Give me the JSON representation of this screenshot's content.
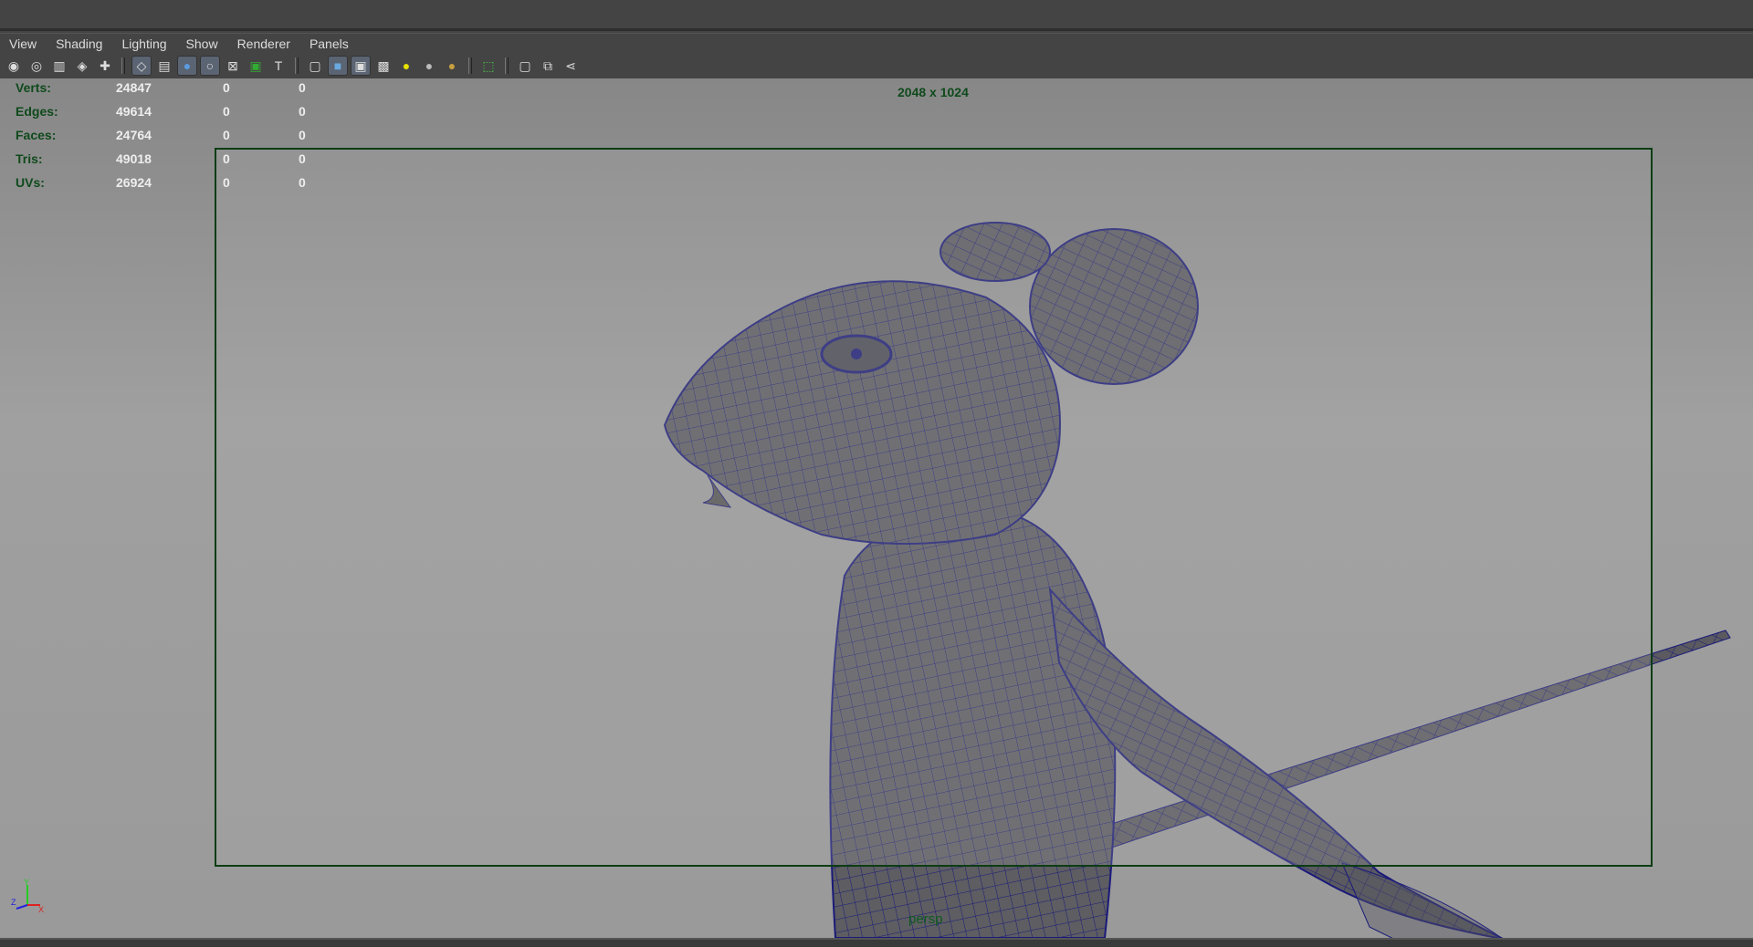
{
  "menu": [
    "View",
    "Shading",
    "Lighting",
    "Show",
    "Renderer",
    "Panels"
  ],
  "toolbar": [
    {
      "icon": "camera-select-icon"
    },
    {
      "icon": "camera-attributes-icon"
    },
    {
      "icon": "bookmark-icon"
    },
    {
      "icon": "image-plane-icon"
    },
    {
      "icon": "camera-pan-zoom-icon"
    },
    {
      "sep": true
    },
    {
      "icon": "grid-icon",
      "on": true
    },
    {
      "icon": "film-gate-icon"
    },
    {
      "icon": "resolution-gate-icon",
      "on": true
    },
    {
      "icon": "gate-mask-icon",
      "on": true
    },
    {
      "icon": "field-chart-icon"
    },
    {
      "icon": "safe-action-icon"
    },
    {
      "icon": "safe-title-icon"
    },
    {
      "sep": true
    },
    {
      "icon": "wireframe-icon"
    },
    {
      "icon": "smooth-shade-icon",
      "on": true
    },
    {
      "icon": "wireframe-on-shaded-icon",
      "on": true
    },
    {
      "icon": "textured-icon"
    },
    {
      "icon": "use-all-lights-icon"
    },
    {
      "icon": "shadows-icon"
    },
    {
      "icon": "ambient-occlusion-icon"
    },
    {
      "sep": true
    },
    {
      "icon": "isolate-select-icon"
    },
    {
      "sep": true
    },
    {
      "icon": "xray-icon"
    },
    {
      "icon": "xray-joints-icon"
    },
    {
      "icon": "xray-active-icon"
    }
  ],
  "hud": {
    "rows": [
      {
        "label": "Verts:",
        "value": "24847",
        "sel": "0",
        "uv": "0"
      },
      {
        "label": "Edges:",
        "value": "49614",
        "sel": "0",
        "uv": "0"
      },
      {
        "label": "Faces:",
        "value": "24764",
        "sel": "0",
        "uv": "0"
      },
      {
        "label": "Tris:",
        "value": "49018",
        "sel": "0",
        "uv": "0"
      },
      {
        "label": "UVs:",
        "value": "26924",
        "sel": "0",
        "uv": "0"
      }
    ],
    "resolution": "2048 x 1024",
    "camera": "persp"
  },
  "axis": {
    "y": "Y",
    "z": "Z",
    "x": "X"
  },
  "colors": {
    "hud_label": "#0f4a1c",
    "wire": "#1a1a7a",
    "mesh": "#5b5b60"
  }
}
